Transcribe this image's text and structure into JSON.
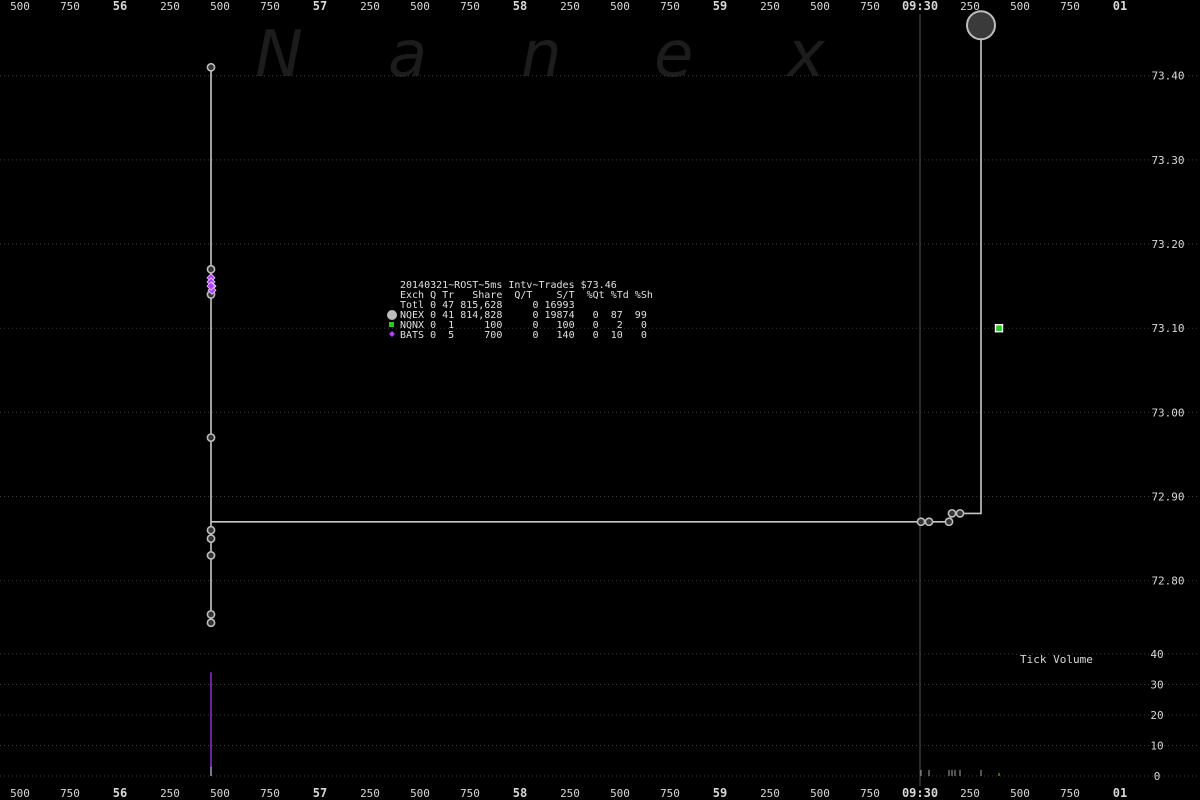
{
  "watermark": [
    "N",
    "a",
    "n",
    "e",
    "x"
  ],
  "chart_data": {
    "type": "line",
    "title": "20140321~ROST~5ms Intv~Trades $73.46",
    "x_ticks": [
      {
        "x": -0.5,
        "label": "500"
      },
      {
        "x": -0.25,
        "label": "750"
      },
      {
        "x": 0,
        "label": "56",
        "major": true
      },
      {
        "x": 0.25,
        "label": "250"
      },
      {
        "x": 0.5,
        "label": "500"
      },
      {
        "x": 0.75,
        "label": "750"
      },
      {
        "x": 1,
        "label": "57",
        "major": true
      },
      {
        "x": 1.25,
        "label": "250"
      },
      {
        "x": 1.5,
        "label": "500"
      },
      {
        "x": 1.75,
        "label": "750"
      },
      {
        "x": 2,
        "label": "58",
        "major": true
      },
      {
        "x": 2.25,
        "label": "250"
      },
      {
        "x": 2.5,
        "label": "500"
      },
      {
        "x": 2.75,
        "label": "750"
      },
      {
        "x": 3,
        "label": "59",
        "major": true
      },
      {
        "x": 3.25,
        "label": "250"
      },
      {
        "x": 3.5,
        "label": "500"
      },
      {
        "x": 3.75,
        "label": "750"
      },
      {
        "x": 4,
        "label": "09:30",
        "major": true
      },
      {
        "x": 4.25,
        "label": "250"
      },
      {
        "x": 4.5,
        "label": "500"
      },
      {
        "x": 4.75,
        "label": "750"
      },
      {
        "x": 5,
        "label": "01",
        "major": true
      }
    ],
    "xlim": [
      -0.5,
      5
    ],
    "price_ticks": [
      72.8,
      72.9,
      73.0,
      73.1,
      73.2,
      73.3,
      73.4
    ],
    "price_ylim": [
      72.72,
      73.49
    ],
    "volume_label": "Tick Volume",
    "volume_ticks": [
      0,
      10,
      20,
      30,
      40
    ],
    "volume_ylim": [
      0,
      40
    ],
    "open_marker_x": 4.0,
    "legend": {
      "header": "Exch Q Tr   Share  Q/T    S/T  %Qt %Td %Sh",
      "rows": [
        {
          "marker": "none",
          "text": "Totl 0 47 815,628     0 16993"
        },
        {
          "marker": "circle",
          "color": "#bdbdbd",
          "text": "NQEX 0 41 814,828     0 19874   0  87  99"
        },
        {
          "marker": "square",
          "color": "#22cc22",
          "text": "NQNX 0  1     100     0   100   0   2   0"
        },
        {
          "marker": "diamond",
          "color": "#b040ff",
          "text": "BATS 0  5     700     0   140   0  10   0"
        }
      ]
    },
    "series": [
      {
        "name": "NQEX",
        "color": "#bdbdbd",
        "marker": "circle",
        "points": [
          {
            "x": 0.455,
            "y": 73.41
          },
          {
            "x": 0.455,
            "y": 73.17
          },
          {
            "x": 0.455,
            "y": 73.14
          },
          {
            "x": 0.455,
            "y": 72.97
          },
          {
            "x": 0.455,
            "y": 72.86
          },
          {
            "x": 0.455,
            "y": 72.85
          },
          {
            "x": 0.455,
            "y": 72.83
          },
          {
            "x": 0.455,
            "y": 72.76
          },
          {
            "x": 0.455,
            "y": 72.75
          },
          {
            "x": 4.005,
            "y": 72.87
          },
          {
            "x": 4.045,
            "y": 72.87
          },
          {
            "x": 4.145,
            "y": 72.87
          },
          {
            "x": 4.16,
            "y": 72.88
          },
          {
            "x": 4.2,
            "y": 72.88
          }
        ],
        "last_trade": {
          "x": 4.305,
          "y": 73.46
        }
      },
      {
        "name": "NQNX",
        "color": "#22cc22",
        "marker": "square",
        "points": [
          {
            "x": 4.395,
            "y": 73.1
          }
        ]
      },
      {
        "name": "BATS",
        "color": "#b040ff",
        "marker": "diamond",
        "points": [
          {
            "x": 0.455,
            "y": 73.16
          },
          {
            "x": 0.455,
            "y": 73.155
          },
          {
            "x": 0.46,
            "y": 73.15
          },
          {
            "x": 0.46,
            "y": 73.145
          },
          {
            "x": 0.455,
            "y": 73.15
          }
        ]
      }
    ],
    "price_path": [
      {
        "x": 0.455,
        "y": 73.41
      },
      {
        "x": 0.455,
        "y": 72.75
      },
      {
        "x": 0.455,
        "y": 72.87
      },
      {
        "x": 4.145,
        "y": 72.87
      },
      {
        "x": 4.16,
        "y": 72.88
      },
      {
        "x": 4.305,
        "y": 72.88
      },
      {
        "x": 4.305,
        "y": 73.46
      }
    ],
    "volume_bars": [
      {
        "x": 0.455,
        "v": 34,
        "color": "#b040ff"
      },
      {
        "x": 0.455,
        "v": 3,
        "color": "#bdbdbd"
      },
      {
        "x": 4.005,
        "v": 2,
        "color": "#888888"
      },
      {
        "x": 4.045,
        "v": 2,
        "color": "#888888"
      },
      {
        "x": 4.145,
        "v": 2,
        "color": "#888888"
      },
      {
        "x": 4.16,
        "v": 2,
        "color": "#888888"
      },
      {
        "x": 4.175,
        "v": 2,
        "color": "#888888"
      },
      {
        "x": 4.2,
        "v": 2,
        "color": "#888888"
      },
      {
        "x": 4.305,
        "v": 2,
        "color": "#888888"
      },
      {
        "x": 4.395,
        "v": 1,
        "color": "#22cc22"
      }
    ]
  }
}
